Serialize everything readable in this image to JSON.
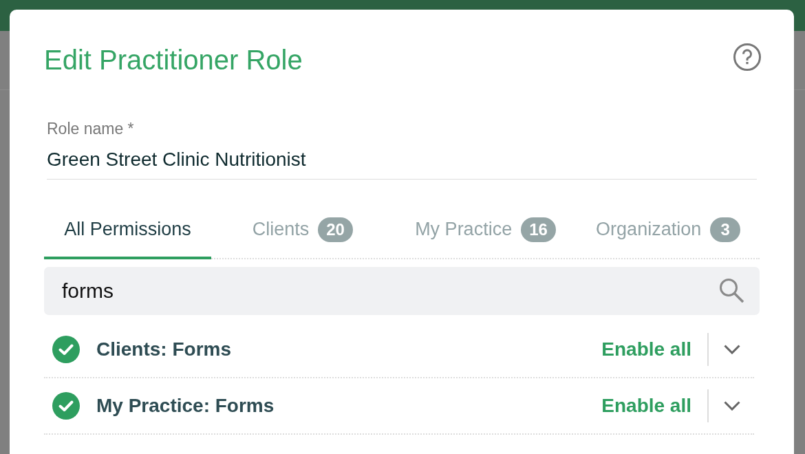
{
  "dialog": {
    "title": "Edit Practitioner Role",
    "role_name": {
      "label": "Role name *",
      "value": "Green Street Clinic Nutritionist"
    },
    "tabs": [
      {
        "label": "All Permissions",
        "selected": true
      },
      {
        "label": "Clients",
        "count": "20",
        "selected": false
      },
      {
        "label": "My Practice",
        "count": "16",
        "selected": false
      },
      {
        "label": "Organization",
        "count": "3",
        "selected": false
      }
    ],
    "search": {
      "value": "forms"
    },
    "permission_groups": [
      {
        "title": "Clients: Forms",
        "checked": true,
        "action": "Enable all",
        "expanded": false
      },
      {
        "title": "My Practice: Forms",
        "checked": true,
        "action": "Enable all",
        "expanded": false
      }
    ]
  }
}
